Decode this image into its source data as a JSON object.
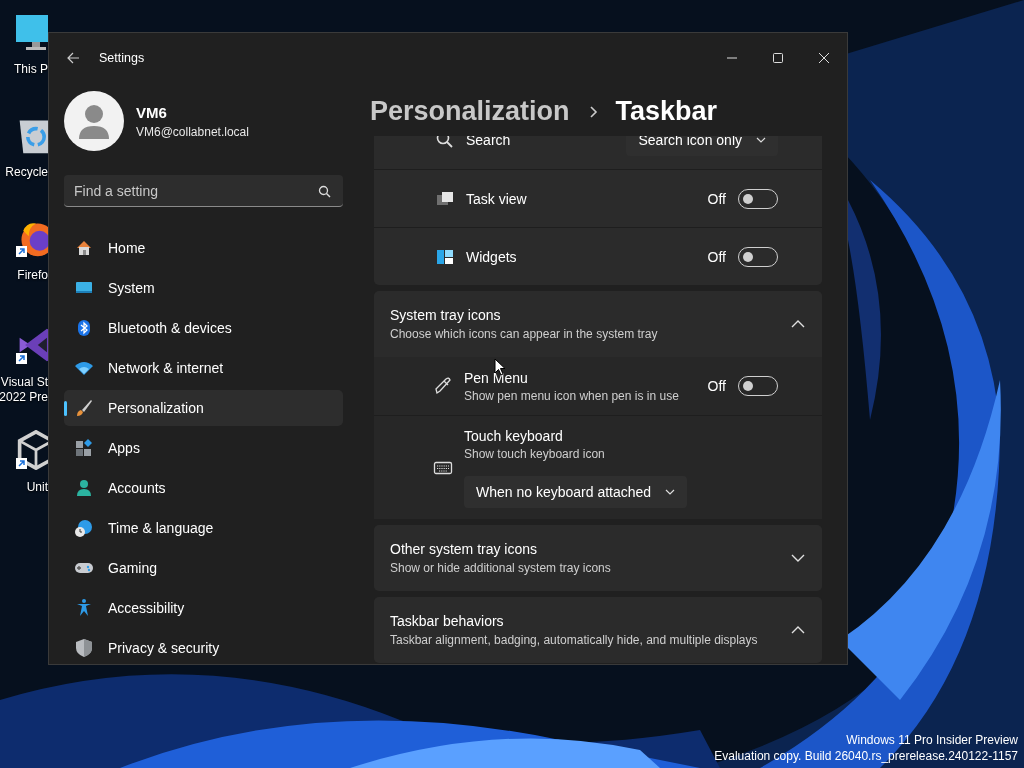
{
  "desktop": {
    "icons": [
      {
        "kind": "monitor",
        "lines": [
          "This P"
        ],
        "shortcut": false
      },
      {
        "kind": "recycle-bin",
        "lines": [
          "Recycle"
        ],
        "shortcut": false
      },
      {
        "kind": "browser",
        "lines": [
          "Firefo"
        ],
        "shortcut": true
      },
      {
        "kind": "studio",
        "lines": [
          "Visual St",
          "2022 Pre"
        ],
        "shortcut": true
      },
      {
        "kind": "cube",
        "lines": [
          "Unit"
        ],
        "shortcut": true
      }
    ],
    "build_info": [
      "Windows 11 Pro Insider Preview",
      "Evaluation copy. Build 26040.rs_prerelease.240122-1157"
    ]
  },
  "window": {
    "title": "Settings"
  },
  "profile": {
    "name": "VM6",
    "email": "VM6@collabnet.local"
  },
  "search": {
    "placeholder": "Find a setting"
  },
  "nav": [
    {
      "label": "Home",
      "selected": false
    },
    {
      "label": "System",
      "selected": false
    },
    {
      "label": "Bluetooth & devices",
      "selected": false
    },
    {
      "label": "Network & internet",
      "selected": false
    },
    {
      "label": "Personalization",
      "selected": true
    },
    {
      "label": "Apps",
      "selected": false
    },
    {
      "label": "Accounts",
      "selected": false
    },
    {
      "label": "Time & language",
      "selected": false
    },
    {
      "label": "Gaming",
      "selected": false
    },
    {
      "label": "Accessibility",
      "selected": false
    },
    {
      "label": "Privacy & security",
      "selected": false
    }
  ],
  "breadcrumb": {
    "parent": "Personalization",
    "current": "Taskbar"
  },
  "sections": [
    {
      "kind": "list",
      "rows": [
        {
          "kind": "dropdown",
          "label": "Search",
          "value": "Search icon only"
        },
        {
          "kind": "toggle",
          "label": "Task view",
          "on": false,
          "state_text": "Off"
        },
        {
          "kind": "toggle",
          "label": "Widgets",
          "on": false,
          "state_text": "Off"
        }
      ]
    },
    {
      "kind": "expander",
      "title": "System tray icons",
      "subtitle": "Choose which icons can appear in the system tray",
      "expanded": true,
      "rows": [
        {
          "kind": "toggle",
          "label": "Pen Menu",
          "description": "Show pen menu icon when pen is in use",
          "on": false,
          "state_text": "Off"
        },
        {
          "kind": "dropdown-below",
          "label": "Touch keyboard",
          "description": "Show touch keyboard icon",
          "value": "When no keyboard attached"
        }
      ]
    },
    {
      "kind": "expander",
      "title": "Other system tray icons",
      "subtitle": "Show or hide additional system tray icons",
      "expanded": false
    },
    {
      "kind": "expander",
      "title": "Taskbar behaviors",
      "subtitle": "Taskbar alignment, badging, automatically hide, and multiple displays",
      "expanded": true
    }
  ]
}
